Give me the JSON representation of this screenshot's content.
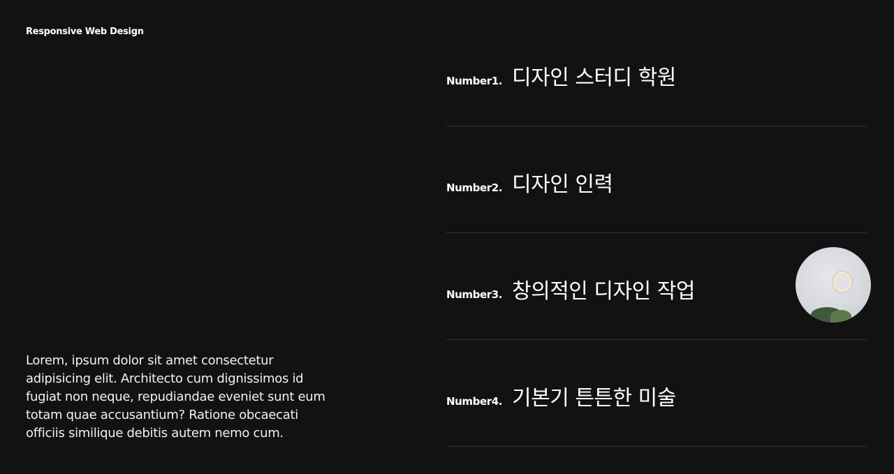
{
  "header": {
    "brand": "Responsive Web Design"
  },
  "intro": {
    "text": "Lorem, ipsum dolor sit amet consectetur adipisicing elit. Architecto cum dignissimos id fugiat non neque, repudiandae eveniet sunt eum totam quae accusantium? Ratione obcaecati officiis similique debitis autem nemo cum."
  },
  "list": {
    "items": [
      {
        "number": "Number1.",
        "title": "디자인 스터디 학원"
      },
      {
        "number": "Number2.",
        "title": "디자인 인력"
      },
      {
        "number": "Number3.",
        "title": "창의적인 디자인 작업",
        "thumbnail": "hanging-ring-plant-photo"
      },
      {
        "number": "Number4.",
        "title": "기본기 튼튼한 미술"
      }
    ]
  },
  "colors": {
    "background": "#121213",
    "text": "#ffffff",
    "divider": "#333334"
  }
}
